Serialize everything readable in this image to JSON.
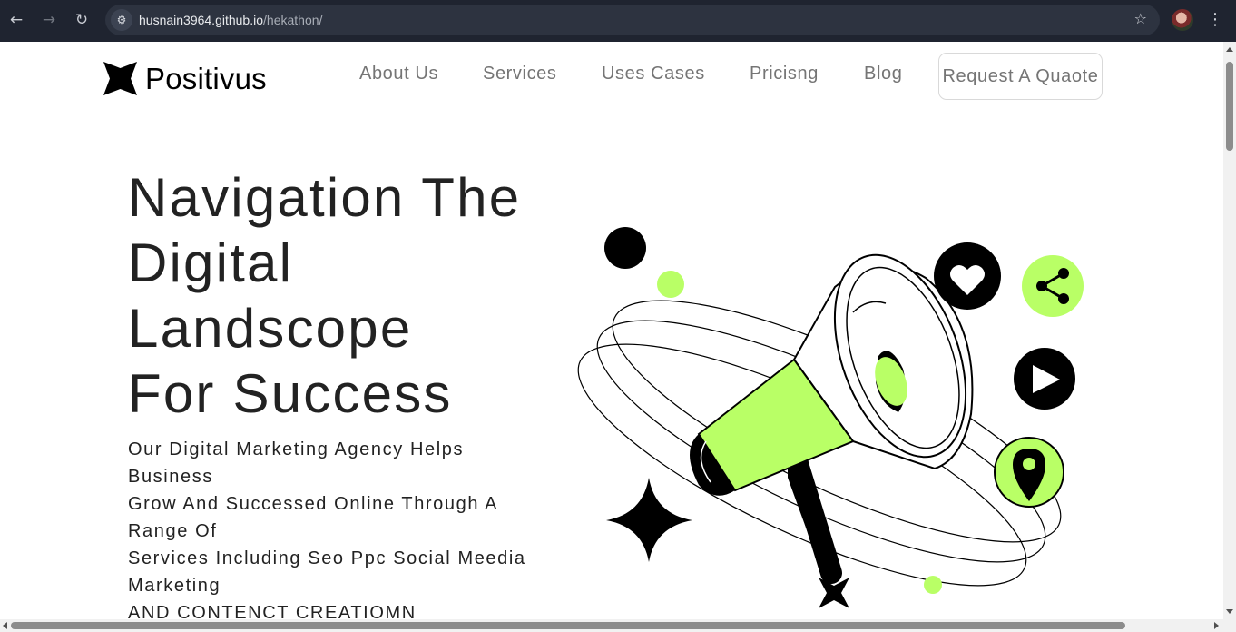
{
  "browser": {
    "back_icon": "←",
    "forward_icon": "→",
    "reload_icon": "↻",
    "site_info_icon": "⚙",
    "url_host": "husnain3964.github.io",
    "url_path": "/hekathon/",
    "bookmark_icon": "☆",
    "menu_icon": "⋮"
  },
  "header": {
    "logo_text": "Positivus",
    "nav": [
      "About Us",
      "Services",
      "Uses Cases",
      "Pricisng",
      "Blog"
    ],
    "cta_label": "Request A Quaote"
  },
  "hero": {
    "title_lines": [
      "Navigation The",
      "Digital",
      "Landscope",
      "For Success"
    ],
    "desc_lines": [
      "Our Digital Marketing Agency Helps",
      "Business",
      "Grow And Successed Online Through A",
      "Range Of",
      "Services Including Seo Ppc Social Meedia",
      "Marketing",
      "AND CONTENCT CREATIOMN"
    ]
  },
  "colors": {
    "accent": "#B9FF66",
    "dark": "#000000",
    "text": "#222222",
    "nav_text": "#757575",
    "chrome_bg": "#1f2430"
  },
  "icons": {
    "illustration": "megaphone-illustration",
    "social": [
      "heart-icon",
      "share-icon",
      "play-icon",
      "location-pin-icon"
    ]
  }
}
